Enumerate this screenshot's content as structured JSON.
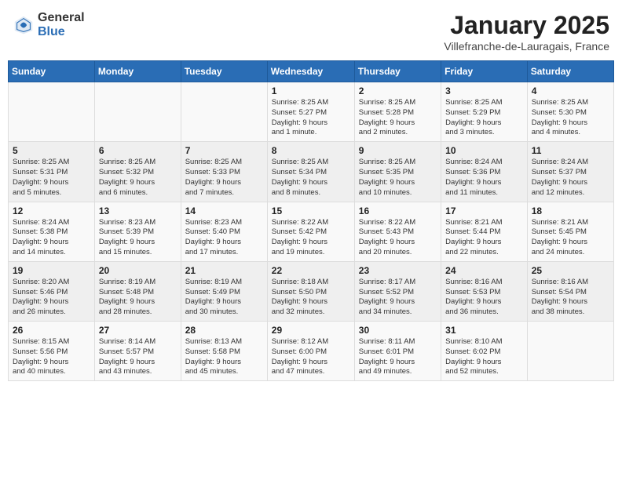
{
  "header": {
    "logo_general": "General",
    "logo_blue": "Blue",
    "main_title": "January 2025",
    "subtitle": "Villefranche-de-Lauragais, France"
  },
  "calendar": {
    "headers": [
      "Sunday",
      "Monday",
      "Tuesday",
      "Wednesday",
      "Thursday",
      "Friday",
      "Saturday"
    ],
    "weeks": [
      [
        {
          "day": "",
          "info": ""
        },
        {
          "day": "",
          "info": ""
        },
        {
          "day": "",
          "info": ""
        },
        {
          "day": "1",
          "info": "Sunrise: 8:25 AM\nSunset: 5:27 PM\nDaylight: 9 hours\nand 1 minute."
        },
        {
          "day": "2",
          "info": "Sunrise: 8:25 AM\nSunset: 5:28 PM\nDaylight: 9 hours\nand 2 minutes."
        },
        {
          "day": "3",
          "info": "Sunrise: 8:25 AM\nSunset: 5:29 PM\nDaylight: 9 hours\nand 3 minutes."
        },
        {
          "day": "4",
          "info": "Sunrise: 8:25 AM\nSunset: 5:30 PM\nDaylight: 9 hours\nand 4 minutes."
        }
      ],
      [
        {
          "day": "5",
          "info": "Sunrise: 8:25 AM\nSunset: 5:31 PM\nDaylight: 9 hours\nand 5 minutes."
        },
        {
          "day": "6",
          "info": "Sunrise: 8:25 AM\nSunset: 5:32 PM\nDaylight: 9 hours\nand 6 minutes."
        },
        {
          "day": "7",
          "info": "Sunrise: 8:25 AM\nSunset: 5:33 PM\nDaylight: 9 hours\nand 7 minutes."
        },
        {
          "day": "8",
          "info": "Sunrise: 8:25 AM\nSunset: 5:34 PM\nDaylight: 9 hours\nand 8 minutes."
        },
        {
          "day": "9",
          "info": "Sunrise: 8:25 AM\nSunset: 5:35 PM\nDaylight: 9 hours\nand 10 minutes."
        },
        {
          "day": "10",
          "info": "Sunrise: 8:24 AM\nSunset: 5:36 PM\nDaylight: 9 hours\nand 11 minutes."
        },
        {
          "day": "11",
          "info": "Sunrise: 8:24 AM\nSunset: 5:37 PM\nDaylight: 9 hours\nand 12 minutes."
        }
      ],
      [
        {
          "day": "12",
          "info": "Sunrise: 8:24 AM\nSunset: 5:38 PM\nDaylight: 9 hours\nand 14 minutes."
        },
        {
          "day": "13",
          "info": "Sunrise: 8:23 AM\nSunset: 5:39 PM\nDaylight: 9 hours\nand 15 minutes."
        },
        {
          "day": "14",
          "info": "Sunrise: 8:23 AM\nSunset: 5:40 PM\nDaylight: 9 hours\nand 17 minutes."
        },
        {
          "day": "15",
          "info": "Sunrise: 8:22 AM\nSunset: 5:42 PM\nDaylight: 9 hours\nand 19 minutes."
        },
        {
          "day": "16",
          "info": "Sunrise: 8:22 AM\nSunset: 5:43 PM\nDaylight: 9 hours\nand 20 minutes."
        },
        {
          "day": "17",
          "info": "Sunrise: 8:21 AM\nSunset: 5:44 PM\nDaylight: 9 hours\nand 22 minutes."
        },
        {
          "day": "18",
          "info": "Sunrise: 8:21 AM\nSunset: 5:45 PM\nDaylight: 9 hours\nand 24 minutes."
        }
      ],
      [
        {
          "day": "19",
          "info": "Sunrise: 8:20 AM\nSunset: 5:46 PM\nDaylight: 9 hours\nand 26 minutes."
        },
        {
          "day": "20",
          "info": "Sunrise: 8:19 AM\nSunset: 5:48 PM\nDaylight: 9 hours\nand 28 minutes."
        },
        {
          "day": "21",
          "info": "Sunrise: 8:19 AM\nSunset: 5:49 PM\nDaylight: 9 hours\nand 30 minutes."
        },
        {
          "day": "22",
          "info": "Sunrise: 8:18 AM\nSunset: 5:50 PM\nDaylight: 9 hours\nand 32 minutes."
        },
        {
          "day": "23",
          "info": "Sunrise: 8:17 AM\nSunset: 5:52 PM\nDaylight: 9 hours\nand 34 minutes."
        },
        {
          "day": "24",
          "info": "Sunrise: 8:16 AM\nSunset: 5:53 PM\nDaylight: 9 hours\nand 36 minutes."
        },
        {
          "day": "25",
          "info": "Sunrise: 8:16 AM\nSunset: 5:54 PM\nDaylight: 9 hours\nand 38 minutes."
        }
      ],
      [
        {
          "day": "26",
          "info": "Sunrise: 8:15 AM\nSunset: 5:56 PM\nDaylight: 9 hours\nand 40 minutes."
        },
        {
          "day": "27",
          "info": "Sunrise: 8:14 AM\nSunset: 5:57 PM\nDaylight: 9 hours\nand 43 minutes."
        },
        {
          "day": "28",
          "info": "Sunrise: 8:13 AM\nSunset: 5:58 PM\nDaylight: 9 hours\nand 45 minutes."
        },
        {
          "day": "29",
          "info": "Sunrise: 8:12 AM\nSunset: 6:00 PM\nDaylight: 9 hours\nand 47 minutes."
        },
        {
          "day": "30",
          "info": "Sunrise: 8:11 AM\nSunset: 6:01 PM\nDaylight: 9 hours\nand 49 minutes."
        },
        {
          "day": "31",
          "info": "Sunrise: 8:10 AM\nSunset: 6:02 PM\nDaylight: 9 hours\nand 52 minutes."
        },
        {
          "day": "",
          "info": ""
        }
      ]
    ]
  }
}
